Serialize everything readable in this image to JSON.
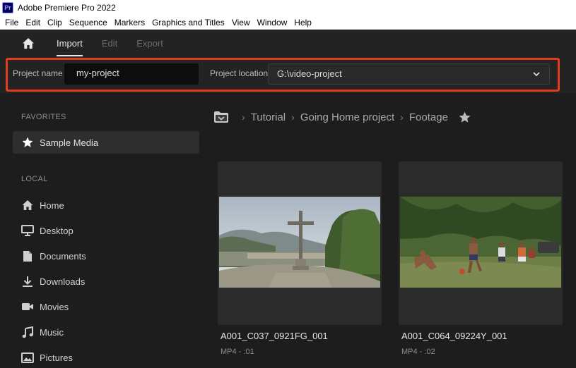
{
  "window": {
    "title": "Adobe Premiere Pro 2022",
    "app_badge": "Pr"
  },
  "menu": [
    "File",
    "Edit",
    "Clip",
    "Sequence",
    "Markers",
    "Graphics and Titles",
    "View",
    "Window",
    "Help"
  ],
  "header": {
    "tabs": [
      "Import",
      "Edit",
      "Export"
    ],
    "active_tab": "Import"
  },
  "project": {
    "name_label": "Project name",
    "name_value": "my-project",
    "location_label": "Project location",
    "location_value": "G:\\video-project"
  },
  "sidebar": {
    "favorites_label": "FAVORITES",
    "favorites": [
      {
        "label": "Sample Media",
        "icon": "star-icon"
      }
    ],
    "local_label": "LOCAL",
    "local": [
      {
        "label": "Home",
        "icon": "home-icon"
      },
      {
        "label": "Desktop",
        "icon": "desktop-icon"
      },
      {
        "label": "Documents",
        "icon": "document-icon"
      },
      {
        "label": "Downloads",
        "icon": "download-icon"
      },
      {
        "label": "Movies",
        "icon": "camera-icon"
      },
      {
        "label": "Music",
        "icon": "music-icon"
      },
      {
        "label": "Pictures",
        "icon": "picture-icon"
      }
    ]
  },
  "breadcrumb": [
    "Tutorial",
    "Going Home project",
    "Footage"
  ],
  "media": [
    {
      "name": "A001_C037_0921FG_001",
      "meta": "MP4 - :01"
    },
    {
      "name": "A001_C064_09224Y_001",
      "meta": "MP4 - :02"
    }
  ],
  "colors": {
    "highlight": "#e63a1e",
    "brand": "#00005b"
  }
}
